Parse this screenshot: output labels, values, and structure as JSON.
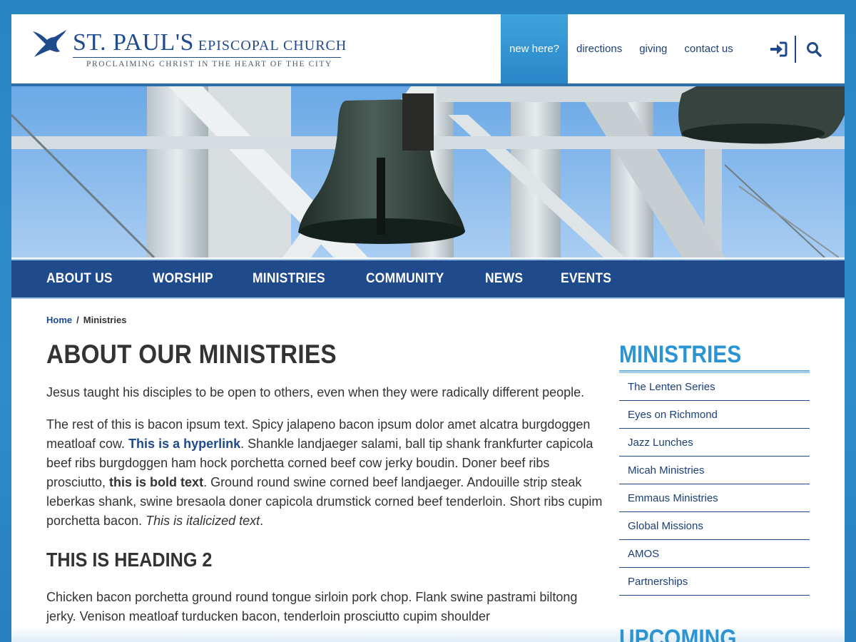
{
  "site": {
    "title_main": "ST. PAUL'S",
    "title_sub": "EPISCOPAL CHURCH",
    "tagline": "PROCLAIMING CHRIST IN THE HEART OF THE CITY"
  },
  "util_nav": {
    "items": [
      "new here?",
      "directions",
      "giving",
      "contact us"
    ],
    "active_index": 0,
    "icons": [
      "sign-in-icon",
      "search-icon"
    ]
  },
  "main_nav": {
    "items": [
      "ABOUT US",
      "WORSHIP",
      "MINISTRIES",
      "COMMUNITY",
      "NEWS",
      "EVENTS"
    ]
  },
  "breadcrumb": {
    "home": "Home",
    "separator": "/",
    "current": "Ministries"
  },
  "content": {
    "title": "ABOUT OUR MINISTRIES",
    "intro": "Jesus taught his disciples to be open to others, even when they were radically different people.",
    "p2_a": "The rest of this is bacon ipsum text. Spicy jalapeno bacon ipsum dolor amet alcatra burgdoggen meatloaf cow. ",
    "p2_link": "This is a hyperlink",
    "p2_b": ". Shankle landjaeger salami, ball tip shank frankfurter capicola beef ribs burgdoggen ham hock porchetta corned beef cow jerky boudin. Doner beef ribs prosciutto, ",
    "p2_bold": "this is bold text",
    "p2_c": ". Ground round swine corned beef landjaeger. Andouille strip steak leberkas shank, swine bresaola doner capicola drumstick corned beef tenderloin. Short ribs cupim porchetta bacon. ",
    "p2_italic": "This is italicized text",
    "p2_d": ".",
    "heading2": "THIS IS HEADING 2",
    "p3": "Chicken bacon porchetta ground round tongue sirloin pork chop. Flank swine pastrami biltong jerky. Venison meatloaf turducken bacon, tenderloin prosciutto cupim shoulder"
  },
  "sidebar": {
    "title": "MINISTRIES",
    "items": [
      "The Lenten Series",
      "Eyes on Richmond",
      "Jazz Lunches",
      "Micah Ministries",
      "Emmaus Ministries",
      "Global Missions",
      "AMOS",
      "Partnerships"
    ],
    "title2": "UPCOMING"
  },
  "colors": {
    "brand_navy": "#1f4a8c",
    "accent_blue": "#2b95d4",
    "text": "#333333"
  }
}
